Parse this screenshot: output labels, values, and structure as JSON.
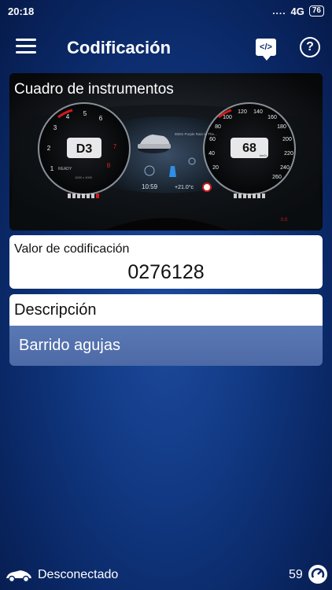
{
  "status_bar": {
    "time": "20:18",
    "signal": "....",
    "network": "4G",
    "battery": "76"
  },
  "app_bar": {
    "title": "Codificación",
    "code_button_glyph": "</>",
    "help_glyph": "?"
  },
  "module_image": {
    "title": "Cuadro de instrumentos",
    "gear": "D3",
    "speed": "68",
    "speed_unit": "km/h",
    "clock": "10:59",
    "temperature": "+21.0°c",
    "nav_text": "900m  Purple Rain In The...",
    "trip": "0.0",
    "odometer": "1000 x 1000",
    "ready_label": "READY",
    "rpm_ticks": [
      "1",
      "2",
      "3",
      "4",
      "5",
      "6",
      "7",
      "8"
    ],
    "speed_ticks": [
      "20",
      "40",
      "60",
      "80",
      "100",
      "120",
      "140",
      "160",
      "180",
      "200",
      "220",
      "240",
      "260"
    ]
  },
  "coding": {
    "label": "Valor de codificación",
    "value": "0276128"
  },
  "description": {
    "label": "Descripción",
    "text": "Barrido agujas"
  },
  "bottom_bar": {
    "connection": "Desconectado",
    "count": "59"
  }
}
